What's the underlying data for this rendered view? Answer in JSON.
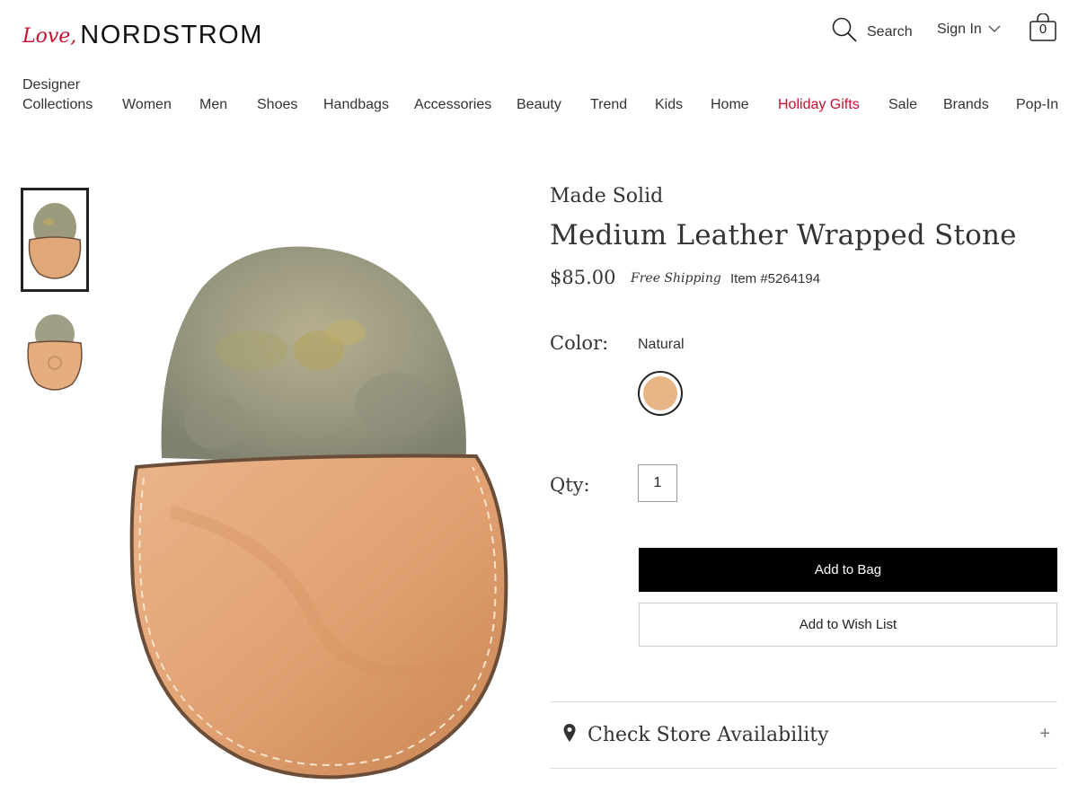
{
  "header": {
    "logo_script": "Love,",
    "logo_brand": "NORDSTROM",
    "search_label": "Search",
    "signin_label": "Sign In",
    "bag_count": "0"
  },
  "nav": {
    "items": [
      {
        "line1": "Designer",
        "line2": "Collections"
      },
      {
        "label": "Women"
      },
      {
        "label": "Men"
      },
      {
        "label": "Shoes"
      },
      {
        "label": "Handbags"
      },
      {
        "label": "Accessories"
      },
      {
        "label": "Beauty"
      },
      {
        "label": "Trend"
      },
      {
        "label": "Kids"
      },
      {
        "label": "Home"
      },
      {
        "label": "Holiday Gifts",
        "highlight": true
      },
      {
        "label": "Sale"
      },
      {
        "label": "Brands"
      },
      {
        "label": "Pop-In"
      }
    ],
    "highlight_color": "#c8102e"
  },
  "product": {
    "brand": "Made Solid",
    "title": "Medium Leather Wrapped Stone",
    "price": "$85.00",
    "shipping": "Free Shipping",
    "item_number": "Item #5264194",
    "color_label": "Color:",
    "color_value": "Natural",
    "swatch_color": "#e8b587",
    "qty_label": "Qty:",
    "qty_value": "1",
    "add_to_bag": "Add to Bag",
    "add_to_wishlist": "Add to Wish List",
    "store_availability": "Check Store Availability",
    "expand_symbol": "+"
  },
  "icons": {
    "search": "search-icon",
    "chevron": "chevron-down-icon",
    "bag": "shopping-bag-icon",
    "pin": "map-pin-icon"
  }
}
